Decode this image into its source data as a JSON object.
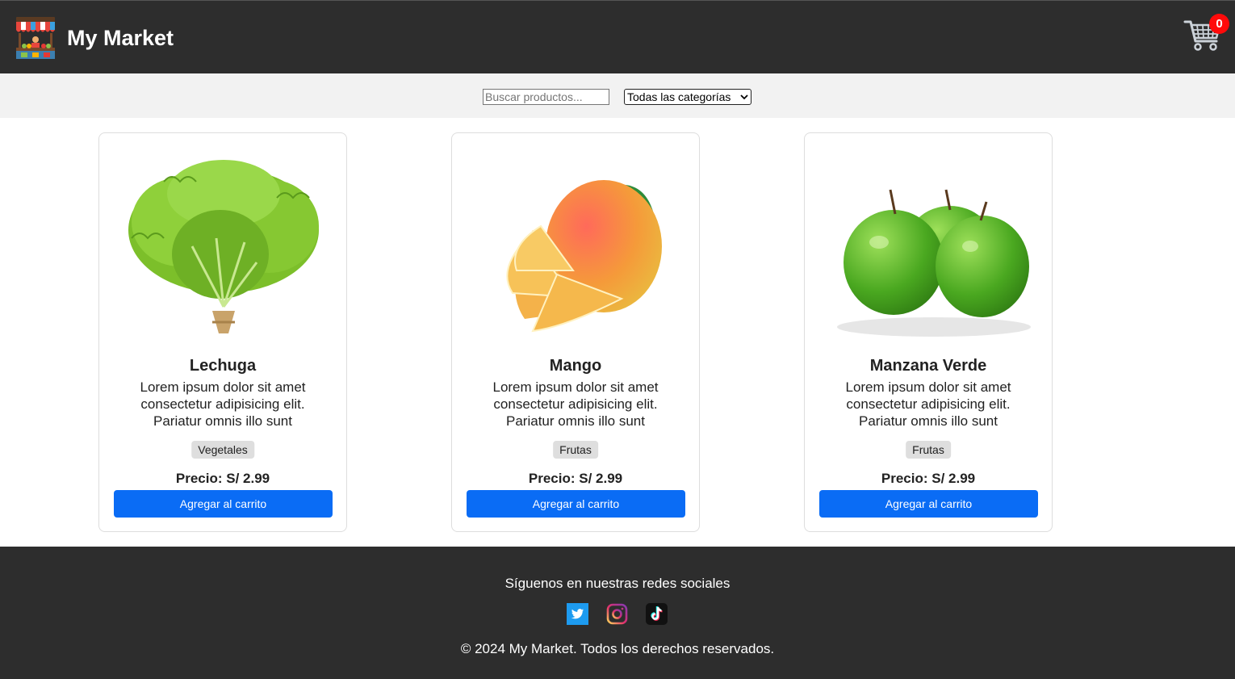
{
  "header": {
    "brand": "My Market",
    "cart_count": "0"
  },
  "filters": {
    "search_placeholder": "Buscar productos...",
    "category_selected": "Todas las categorías"
  },
  "products": [
    {
      "name": "Lechuga",
      "description": "Lorem ipsum dolor sit amet consectetur adipisicing elit. Pariatur omnis illo sunt",
      "category": "Vegetales",
      "price": "Precio: S/ 2.99",
      "button": "Agregar al carrito"
    },
    {
      "name": "Mango",
      "description": "Lorem ipsum dolor sit amet consectetur adipisicing elit. Pariatur omnis illo sunt",
      "category": "Frutas",
      "price": "Precio: S/ 2.99",
      "button": "Agregar al carrito"
    },
    {
      "name": "Manzana Verde",
      "description": "Lorem ipsum dolor sit amet consectetur adipisicing elit. Pariatur omnis illo sunt",
      "category": "Frutas",
      "price": "Precio: S/ 2.99",
      "button": "Agregar al carrito"
    }
  ],
  "footer": {
    "follow_text": "Síguenos en nuestras redes sociales",
    "copyright": "© 2024 My Market. Todos los derechos reservados.",
    "social_icons": [
      "twitter-icon",
      "instagram-icon",
      "tiktok-icon"
    ]
  },
  "colors": {
    "header_bg": "#2d2d2d",
    "filter_bg": "#f2f2f2",
    "button_blue": "#0a6cf5",
    "badge_red": "#ff0a0a",
    "tag_bg": "#dedede"
  }
}
